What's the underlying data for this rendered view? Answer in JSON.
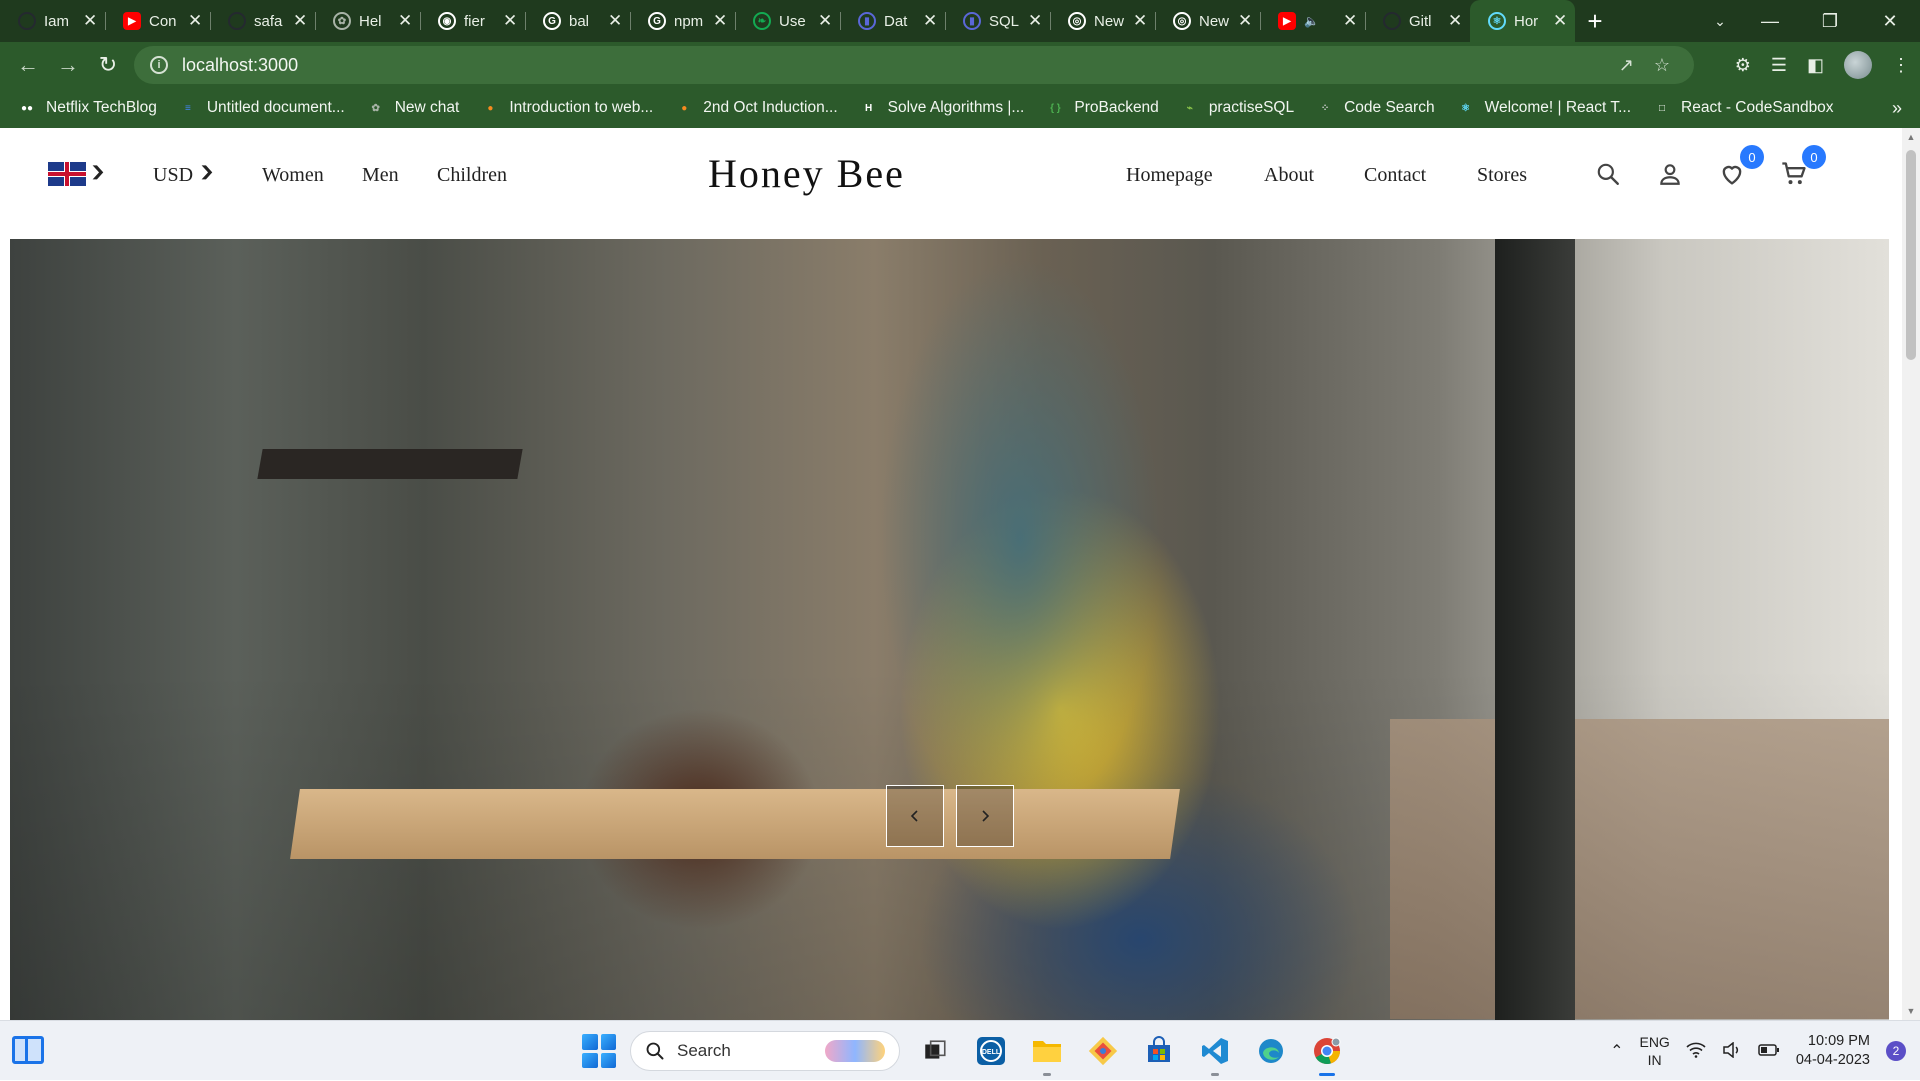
{
  "browser": {
    "tabs": [
      {
        "title": "Iam",
        "fav": "github",
        "fav_color": "#24292f"
      },
      {
        "title": "Con",
        "fav": "youtube",
        "fav_color": "#ff0000"
      },
      {
        "title": "safa",
        "fav": "github",
        "fav_color": "#24292f"
      },
      {
        "title": "Hel",
        "fav": "openai",
        "fav_color": "#a8b3a7"
      },
      {
        "title": "fier",
        "fav": "site",
        "fav_color": "#ffffff"
      },
      {
        "title": "bal",
        "fav": "google",
        "fav_color": "#ffffff"
      },
      {
        "title": "npm",
        "fav": "google",
        "fav_color": "#ffffff"
      },
      {
        "title": "Use",
        "fav": "mongodb",
        "fav_color": "#13aa52"
      },
      {
        "title": "Dat",
        "fav": "prisma",
        "fav_color": "#5a67d8"
      },
      {
        "title": "SQL",
        "fav": "prisma",
        "fav_color": "#5a67d8"
      },
      {
        "title": "New",
        "fav": "chrome",
        "fav_color": "#ffffff"
      },
      {
        "title": "New",
        "fav": "chrome",
        "fav_color": "#ffffff"
      },
      {
        "title": "",
        "fav": "youtube",
        "fav_color": "#ff0000",
        "audio": true
      },
      {
        "title": "Gitl",
        "fav": "github",
        "fav_color": "#24292f"
      },
      {
        "title": "Hor",
        "fav": "react",
        "fav_color": "#61dafb",
        "active": true
      }
    ],
    "url": "localhost:3000",
    "bookmarks": [
      {
        "label": "Netflix TechBlog",
        "icon": "medium",
        "color": "#ffffff"
      },
      {
        "label": "Untitled document...",
        "icon": "docs",
        "color": "#4285f4"
      },
      {
        "label": "New chat",
        "icon": "openai",
        "color": "#a8b3a7"
      },
      {
        "label": "Introduction to web...",
        "icon": "circle",
        "color": "#f58a1f"
      },
      {
        "label": "2nd Oct Induction...",
        "icon": "circle",
        "color": "#f58a1f"
      },
      {
        "label": "Solve Algorithms |...",
        "icon": "hackerrank",
        "color": "#ffffff"
      },
      {
        "label": "ProBackend",
        "icon": "code",
        "color": "#4caf50"
      },
      {
        "label": "practiseSQL",
        "icon": "sql",
        "color": "#8bc34a"
      },
      {
        "label": "Code Search",
        "icon": "dots",
        "color": "#cccccc"
      },
      {
        "label": "Welcome! | React T...",
        "icon": "react",
        "color": "#61dafb"
      },
      {
        "label": "React - CodeSandbox",
        "icon": "box",
        "color": "#ffffff"
      }
    ],
    "more": "»"
  },
  "site": {
    "currency": "USD",
    "left_links": [
      "Women",
      "Men",
      "Children"
    ],
    "logo": "Honey Bee",
    "right_links": [
      "Homepage",
      "About",
      "Contact",
      "Stores"
    ],
    "wishlist_count": "0",
    "cart_count": "0",
    "accent": "#2879fe"
  },
  "taskbar": {
    "search_placeholder": "Search",
    "lang_line1": "ENG",
    "lang_line2": "IN",
    "time": "10:09 PM",
    "date": "04-04-2023",
    "notifications": "2"
  }
}
